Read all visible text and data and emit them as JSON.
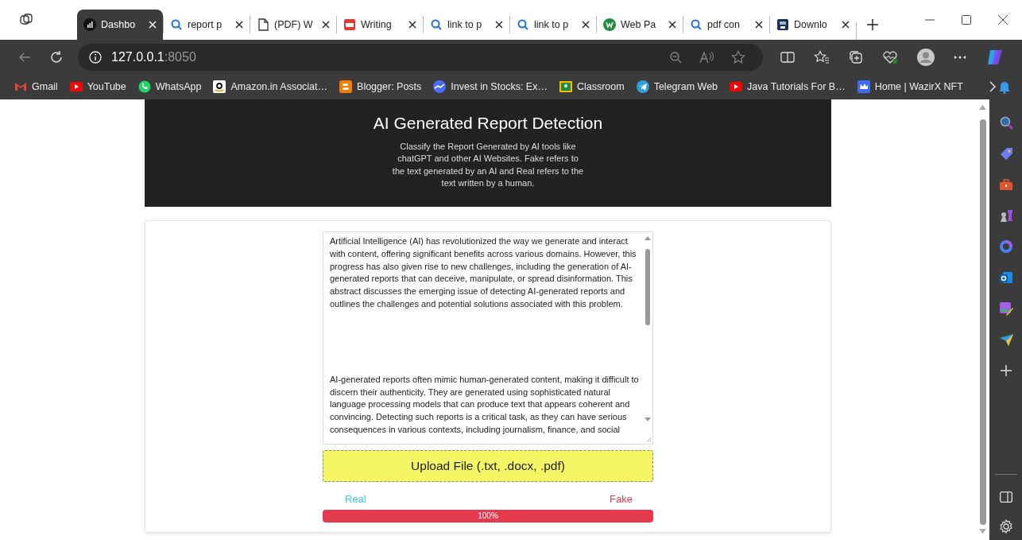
{
  "tabs": [
    {
      "kind": "dashboard",
      "label": "Dashbo",
      "selected": true
    },
    {
      "kind": "search",
      "label": "report p",
      "selected": false
    },
    {
      "kind": "document",
      "label": "(PDF) W",
      "selected": false
    },
    {
      "kind": "pdf",
      "label": "Writing",
      "selected": false
    },
    {
      "kind": "search",
      "label": "link to p",
      "selected": false
    },
    {
      "kind": "search",
      "label": "link to p",
      "selected": false
    },
    {
      "kind": "w",
      "label": "Web Pa",
      "selected": false
    },
    {
      "kind": "search",
      "label": "pdf con",
      "selected": false
    },
    {
      "kind": "app",
      "label": "Downlo",
      "selected": false
    }
  ],
  "address": {
    "host": "127.0.0.1",
    "port": ":8050"
  },
  "bookmarks": [
    {
      "kind": "gmail",
      "label": "Gmail"
    },
    {
      "kind": "youtube",
      "label": "YouTube"
    },
    {
      "kind": "whatsapp",
      "label": "WhatsApp"
    },
    {
      "kind": "amazon",
      "label": "Amazon.in Associat…"
    },
    {
      "kind": "blogger",
      "label": "Blogger: Posts"
    },
    {
      "kind": "chart",
      "label": "Invest in Stocks: Ex…"
    },
    {
      "kind": "classroom",
      "label": "Classroom"
    },
    {
      "kind": "telegram",
      "label": "Telegram Web"
    },
    {
      "kind": "youtube",
      "label": "Java Tutorials For B…"
    },
    {
      "kind": "crown",
      "label": "Home | WazirX NFT"
    }
  ],
  "page": {
    "title": "AI Generated Report Detection",
    "subtitle": "Classify the Report Generated by AI tools like chatGPT and other AI Websites. Fake refers to the text generated by an AI and Real refers to the text written by a human.",
    "report_text": [
      "Artificial Intelligence (AI) has revolutionized the way we generate and interact with content, offering significant benefits across various domains. However, this progress has also given rise to new challenges, including the generation of AI-generated reports that can deceive, manipulate, or spread disinformation. This abstract discusses the emerging issue of detecting AI-generated reports and outlines the challenges and potential solutions associated with this problem.",
      "AI-generated reports often mimic human-generated content, making it difficult to discern their authenticity. They are generated using sophisticated natural language processing models that can produce text that appears coherent and convincing. Detecting such reports is a critical task, as they can have serious consequences in various contexts, including journalism, finance, and social"
    ],
    "upload_label": "Upload File (.txt, .docx, .pdf)",
    "real_label": "Real",
    "fake_label": "Fake",
    "result": {
      "level": 1,
      "reading": "100%"
    }
  }
}
